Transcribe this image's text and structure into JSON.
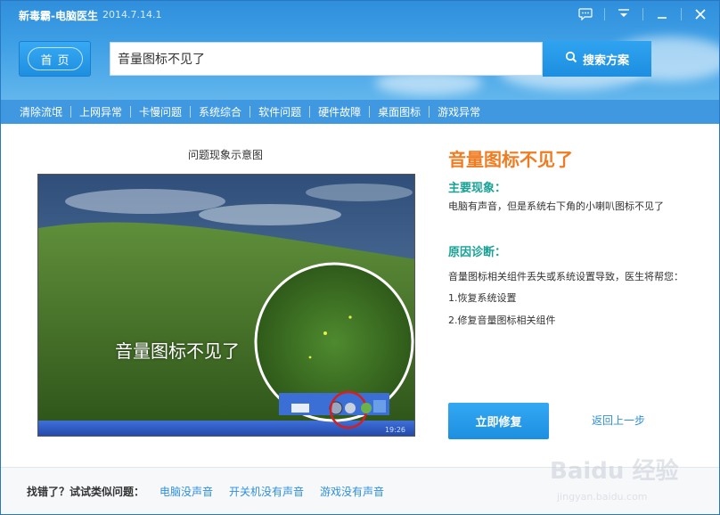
{
  "app": {
    "title": "新毒霸-电脑医生",
    "version": "2014.7.14.1"
  },
  "window_controls": {
    "icons": [
      "chat-icon",
      "menu-icon",
      "minimize-icon",
      "close-icon"
    ]
  },
  "header": {
    "home_label": "首页",
    "search_value": "音量图标不见了",
    "search_button_label": "搜索方案"
  },
  "categories": [
    "清除流氓",
    "上网异常",
    "卡慢问题",
    "系统综合",
    "软件问题",
    "硬件故障",
    "桌面图标",
    "游戏异常"
  ],
  "illustration": {
    "caption": "问题现象示意图",
    "overlay_text": "音量图标不见了",
    "taskbar_clock": "19:26"
  },
  "issue": {
    "title": "音量图标不见了",
    "symptom_heading": "主要现象：",
    "symptom_text": "电脑有声音，但是系统右下角的小喇叭图标不见了",
    "diagnosis_heading": "原因诊断：",
    "diagnosis_text": "音量图标相关组件丢失或系统设置导致，医生将帮您：",
    "steps": [
      "1.恢复系统设置",
      "2.修复音量图标相关组件"
    ]
  },
  "actions": {
    "fix_label": "立即修复",
    "back_label": "返回上一步"
  },
  "footer": {
    "label": "找错了？试试类似问题：",
    "links": [
      "电脑没声音",
      "开关机没有声音",
      "游戏没有声音"
    ]
  },
  "watermark": {
    "text": "Baidu 经验",
    "url_text": "jingyan.baidu.com"
  },
  "colors": {
    "accent": "#2f8fdc",
    "title_orange": "#f07c22",
    "section_green": "#1aa196"
  }
}
